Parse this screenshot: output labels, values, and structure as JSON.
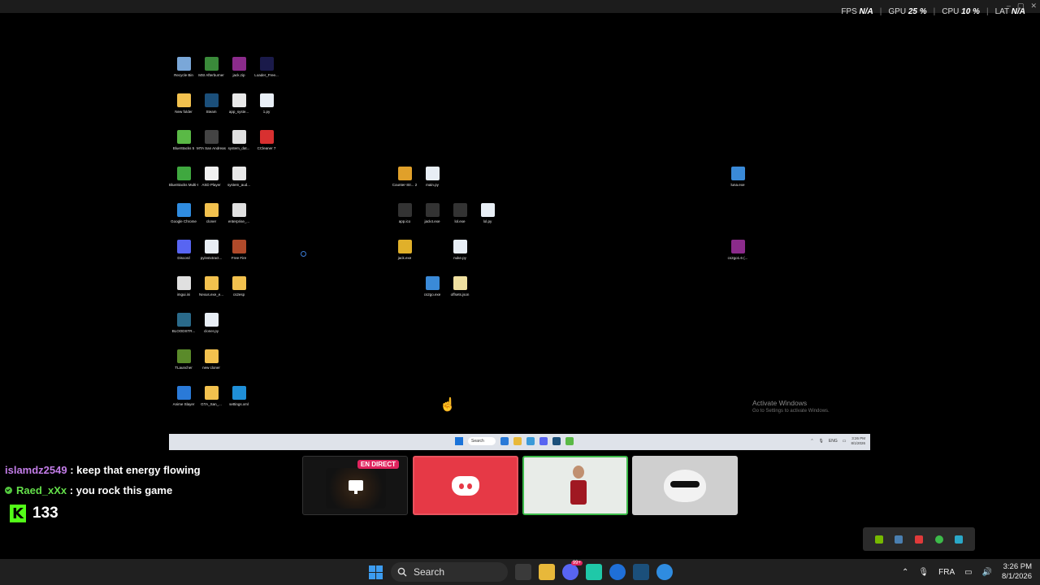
{
  "overlay": {
    "perf": [
      {
        "label": "FPS",
        "value": "N/A"
      },
      {
        "label": "GPU",
        "value": "25 %"
      },
      {
        "label": "CPU",
        "value": "10 %"
      },
      {
        "label": "LAT",
        "value": "N/A"
      }
    ]
  },
  "desktop_icons": [
    {
      "label": "Recycle Bin",
      "icon": "recycle-bin-icon",
      "color": "#7aa7d8"
    },
    {
      "label": "MSI Afterburner",
      "icon": "afterburner-icon",
      "color": "#3a8a3a"
    },
    {
      "label": "jack.zip",
      "icon": "winrar-icon",
      "color": "#8b2b8b"
    },
    {
      "label": "Loader_Free...",
      "icon": "nh-icon",
      "color": "#1a1a4a"
    },
    {
      "label": "New folder",
      "icon": "folder-icon",
      "color": "#f2c14e"
    },
    {
      "label": "Steam",
      "icon": "steam-icon",
      "color": "#1b4f7a"
    },
    {
      "label": "app_syste...",
      "icon": "file-icon",
      "color": "#e8e8e8"
    },
    {
      "label": "1.py",
      "icon": "python-file-icon",
      "color": "#e8eef5"
    },
    {
      "label": "BlueStacks 5",
      "icon": "bluestacks-icon",
      "color": "#5ab946"
    },
    {
      "label": "MTA San Andreas 1.6",
      "icon": "mta-icon",
      "color": "#444"
    },
    {
      "label": "system_dat...",
      "icon": "settings-file-icon",
      "color": "#e0e0e0"
    },
    {
      "label": "CCleaner 7",
      "icon": "ccleaner-icon",
      "color": "#d83030"
    },
    {
      "label": "BlueStacks Multi-Insta...",
      "icon": "bluestacks-multi-icon",
      "color": "#3fa83f"
    },
    {
      "label": "ASD Player",
      "icon": "play-icon",
      "color": "#f0f0f0"
    },
    {
      "label": "system_aud...",
      "icon": "file-icon",
      "color": "#e8e8e8"
    },
    {
      "label": "Google Chrome",
      "icon": "chrome-icon",
      "color": "#2f8ce0"
    },
    {
      "label": "cloner",
      "icon": "folder-icon",
      "color": "#f2c14e"
    },
    {
      "label": "enterprise_...",
      "icon": "settings-file-icon",
      "color": "#e0e0e0"
    },
    {
      "label": "Discord",
      "icon": "discord-icon",
      "color": "#5865f2"
    },
    {
      "label": "pyinstxtract...",
      "icon": "python-file-icon",
      "color": "#e8eef5"
    },
    {
      "label": "Free Fire",
      "icon": "freefire-icon",
      "color": "#b04a2a"
    },
    {
      "label": "imgui.ini",
      "icon": "settings-file-icon",
      "color": "#e0e0e0"
    },
    {
      "label": "Nexus.exe_e...",
      "icon": "folder-icon",
      "color": "#f2c14e"
    },
    {
      "label": "cs2esp",
      "icon": "folder-icon",
      "color": "#f2c14e"
    },
    {
      "label": "BLOODSTR...",
      "icon": "bloodstrike-icon",
      "color": "#2a6a8a"
    },
    {
      "label": "cloner.py",
      "icon": "python-file-icon",
      "color": "#e8eef5"
    },
    {
      "label": "TLauncher",
      "icon": "tlauncher-icon",
      "color": "#5a8a2a"
    },
    {
      "label": "new cloner",
      "icon": "folder-icon",
      "color": "#f2c14e"
    },
    {
      "label": "Anime Slayer",
      "icon": "anime-slayer-icon",
      "color": "#2a7ad8"
    },
    {
      "label": "GTA_San_...",
      "icon": "folder-icon",
      "color": "#f2c14e"
    },
    {
      "label": "settings.xml",
      "icon": "edge-icon",
      "color": "#1f8fd8"
    },
    {
      "label": "Counter-Str... 2",
      "icon": "cs2-icon",
      "color": "#e0a02a"
    },
    {
      "label": "main.py",
      "icon": "python-file-icon",
      "color": "#e8eef5"
    },
    {
      "label": "app.ico",
      "icon": "ico-icon",
      "color": "#333"
    },
    {
      "label": "jack4.exe",
      "icon": "exe-icon",
      "color": "#333"
    },
    {
      "label": "lol.exe",
      "icon": "exe-icon",
      "color": "#333"
    },
    {
      "label": "lol.py",
      "icon": "python-file-icon",
      "color": "#e8eef5"
    },
    {
      "label": "jack.exe",
      "icon": "python-exe-icon",
      "color": "#e0b02a"
    },
    {
      "label": "nuke.py",
      "icon": "python-file-icon",
      "color": "#e8eef5"
    },
    {
      "label": "cs2go.exe",
      "icon": "app-window-icon",
      "color": "#3a8ad8"
    },
    {
      "label": "offsets.json",
      "icon": "json-file-icon",
      "color": "#f0e0a0"
    },
    {
      "label": "luna.exe",
      "icon": "app-window-icon",
      "color": "#3a8ad8"
    },
    {
      "label": "cs2go1.6 (...",
      "icon": "winrar-icon",
      "color": "#8b2b8b"
    }
  ],
  "activation": {
    "title": "Activate Windows",
    "subtitle": "Go to Settings to activate Windows."
  },
  "inner_taskbar": {
    "search": "Search",
    "lang": "ENG",
    "time": "3:26 PM",
    "date": "8/1/2026"
  },
  "chat": [
    {
      "user": "islamdz2549",
      "message": ": keep that energy flowing"
    },
    {
      "user": "Raed_xXx",
      "message": ": you rock this game"
    }
  ],
  "kick": {
    "logo": "K",
    "count": "133"
  },
  "tiles": {
    "live_badge": "EN DIRECT"
  },
  "taskbar": {
    "search_placeholder": "Search",
    "discord_badge": "99+",
    "lang": "FRA",
    "time": "3:26 PM",
    "date": "8/1/2026"
  },
  "colors": {
    "accent_blue": "#3c9cf0",
    "discord_tile": "#e63946",
    "live_red": "#e0245e",
    "kick_green": "#53fc18"
  }
}
